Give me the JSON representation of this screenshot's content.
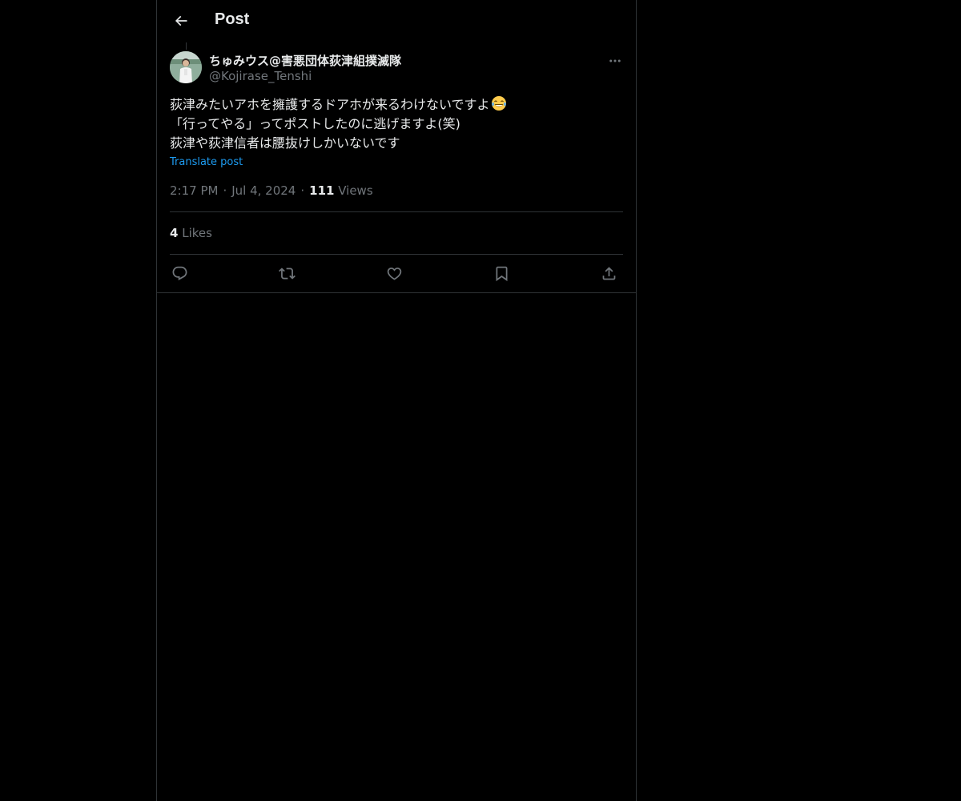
{
  "header": {
    "title": "Post",
    "back_icon": "arrow-left-icon"
  },
  "post": {
    "author": {
      "display_name": "ちゅみウス@害悪団体荻津組撲滅隊",
      "handle": "@Kojirase_Tenshi"
    },
    "text_lines": [
      "荻津みたいアホを擁護するドアホが来るわけないですよ",
      "「行ってやる」ってポストしたのに逃げますよ(笑)",
      "荻津や荻津信者は腰抜けしかいないです"
    ],
    "emoji": "😂",
    "translate_label": "Translate post",
    "time": "2:17 PM",
    "date": "Jul 4, 2024",
    "separator": "·",
    "views_count": "111",
    "views_label": "Views",
    "likes_count": "4",
    "likes_label": "Likes"
  },
  "actions": {
    "reply_icon": "reply-icon",
    "repost_icon": "repost-icon",
    "like_icon": "heart-icon",
    "bookmark_icon": "bookmark-icon",
    "share_icon": "share-icon"
  },
  "colors": {
    "background": "#000000",
    "text_primary": "#e7e9ea",
    "text_secondary": "#71767b",
    "link": "#1d9bf0",
    "border": "#2f3336"
  }
}
